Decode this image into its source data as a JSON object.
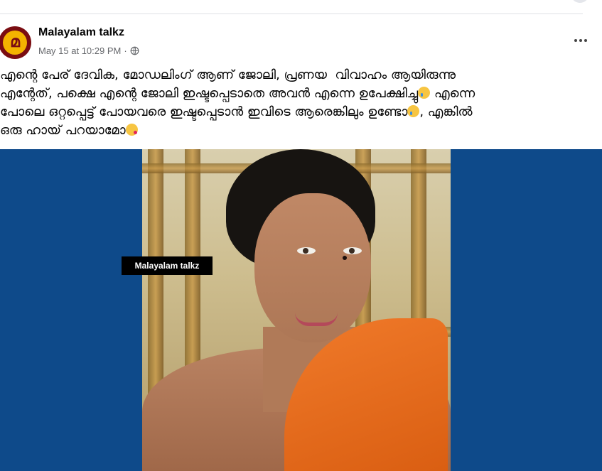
{
  "post": {
    "page_name": "Malayalam talkz",
    "avatar_letter": "മ",
    "timestamp": "May 15 at 10:29 PM",
    "separator": "·",
    "privacy_icon": "globe-icon",
    "more_icon": "more-options-icon",
    "text_lines": [
      "എന്റെ പേര് ദേവിക, മോഡലിംഗ് ആണ് ജോലി, പ്രണയ  വിവാഹം ആയിരുന്നു",
      "എന്റേത്, പക്ഷെ എന്റെ ജോലി ഇഷ്ടപ്പെടാതെ അവൻ എന്നെ ഉപേക്ഷിച്ചു",
      "എന്നെ",
      "പോലെ ഒറ്റപ്പെട്ട് പോയവരെ ഇഷ്ടപ്പെടാൻ ഇവിടെ ആരെങ്കിലും ഉണ്ടോ",
      ", എങ്കിൽ",
      "ഒരു ഹായ് പറയാമോ"
    ],
    "emojis": [
      "crying-face-emoji",
      "crying-face-emoji",
      "face-blowing-kiss-emoji"
    ]
  },
  "media": {
    "watermark_text": "Malayalam talkz",
    "background_color": "#0e4a8a",
    "accent_saree": "#f07a2a"
  }
}
